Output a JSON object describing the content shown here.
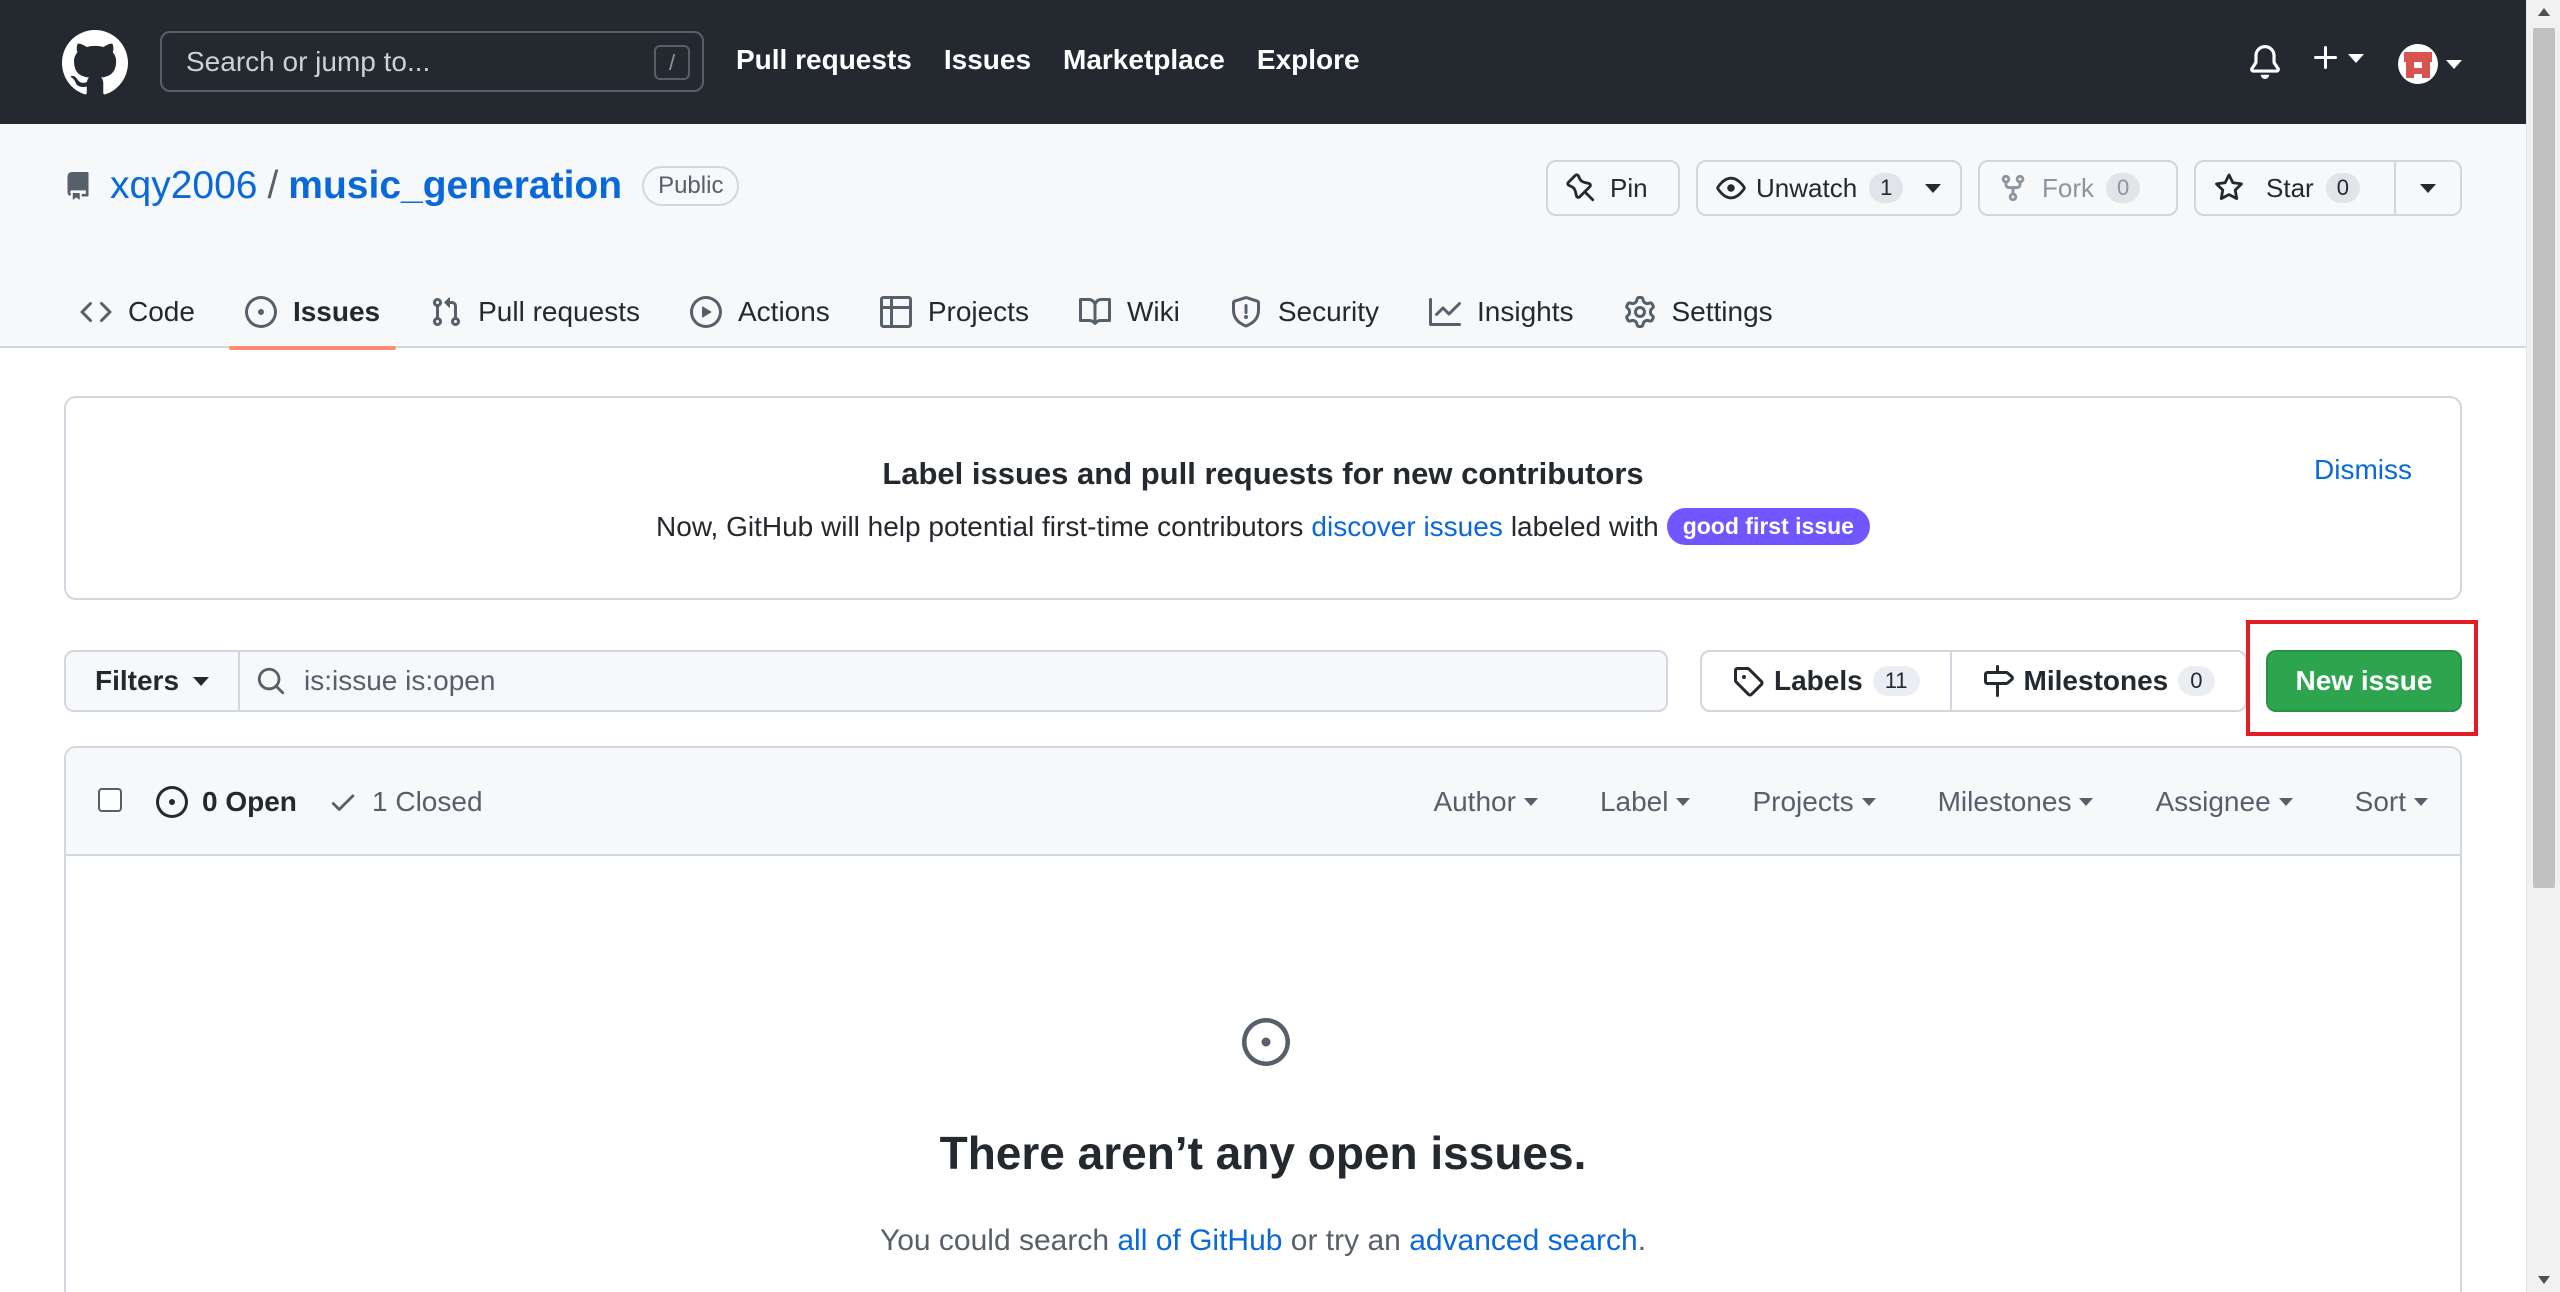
{
  "header": {
    "search_placeholder": "Search or jump to...",
    "search_shortcut": "/",
    "nav": [
      "Pull requests",
      "Issues",
      "Marketplace",
      "Explore"
    ]
  },
  "repo": {
    "owner": "xqy2006",
    "separator": "/",
    "name": "music_generation",
    "visibility": "Public",
    "actions": {
      "pin_label": "Pin",
      "unwatch_label": "Unwatch",
      "unwatch_count": "1",
      "fork_label": "Fork",
      "fork_count": "0",
      "star_label": "Star",
      "star_count": "0"
    },
    "tabs": [
      "Code",
      "Issues",
      "Pull requests",
      "Actions",
      "Projects",
      "Wiki",
      "Security",
      "Insights",
      "Settings"
    ],
    "active_tab": "Issues"
  },
  "banner": {
    "title": "Label issues and pull requests for new contributors",
    "text_before": "Now, GitHub will help potential first-time contributors",
    "link": "discover issues",
    "text_after": "labeled with",
    "label": "good first issue",
    "dismiss": "Dismiss"
  },
  "filterbar": {
    "filters_label": "Filters",
    "query": "is:issue is:open",
    "labels_label": "Labels",
    "labels_count": "11",
    "milestones_label": "Milestones",
    "milestones_count": "0",
    "new_issue_label": "New issue"
  },
  "issues": {
    "open_label": "0 Open",
    "closed_label": "1 Closed",
    "filters": [
      "Author",
      "Label",
      "Projects",
      "Milestones",
      "Assignee",
      "Sort"
    ],
    "empty_title": "There aren’t any open issues.",
    "empty_text_before": "You could search",
    "empty_link1": "all of GitHub",
    "empty_text_mid": "or try an",
    "empty_link2": "advanced search",
    "empty_text_after": "."
  },
  "colors": {
    "header_bg": "#24292f",
    "link": "#0969da",
    "primary_button": "#2da44e",
    "active_tab_underline": "#fd8c73",
    "good_first_issue": "#7057ff",
    "highlight_frame": "#e01e24"
  }
}
